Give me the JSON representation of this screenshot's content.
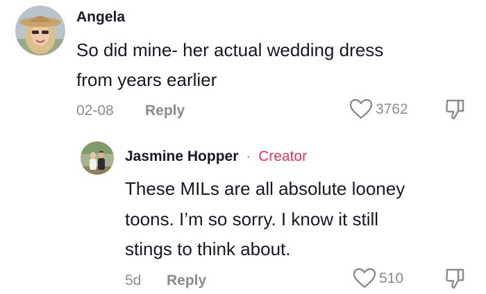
{
  "comment": {
    "author": "Angela",
    "text_line1": "So did mine- her actual wedding dress",
    "text_line2": "from years earlier",
    "date": "02-08",
    "reply_label": "Reply",
    "like_count": "3762"
  },
  "reply": {
    "author": "Jasmine Hopper",
    "separator": "·",
    "badge": "Creator",
    "text_line1": "These MILs are all absolute looney",
    "text_line2": "toons. I’m so sorry. I know it still",
    "text_line3": "stings to think about.",
    "date": "5d",
    "reply_label": "Reply",
    "like_count": "510"
  },
  "icons": {
    "like": "heart-icon",
    "dislike": "thumbs-down-icon"
  },
  "colors": {
    "creator_accent": "#fe2c55",
    "meta_gray": "#8a8b91",
    "text_dark": "#161823"
  }
}
